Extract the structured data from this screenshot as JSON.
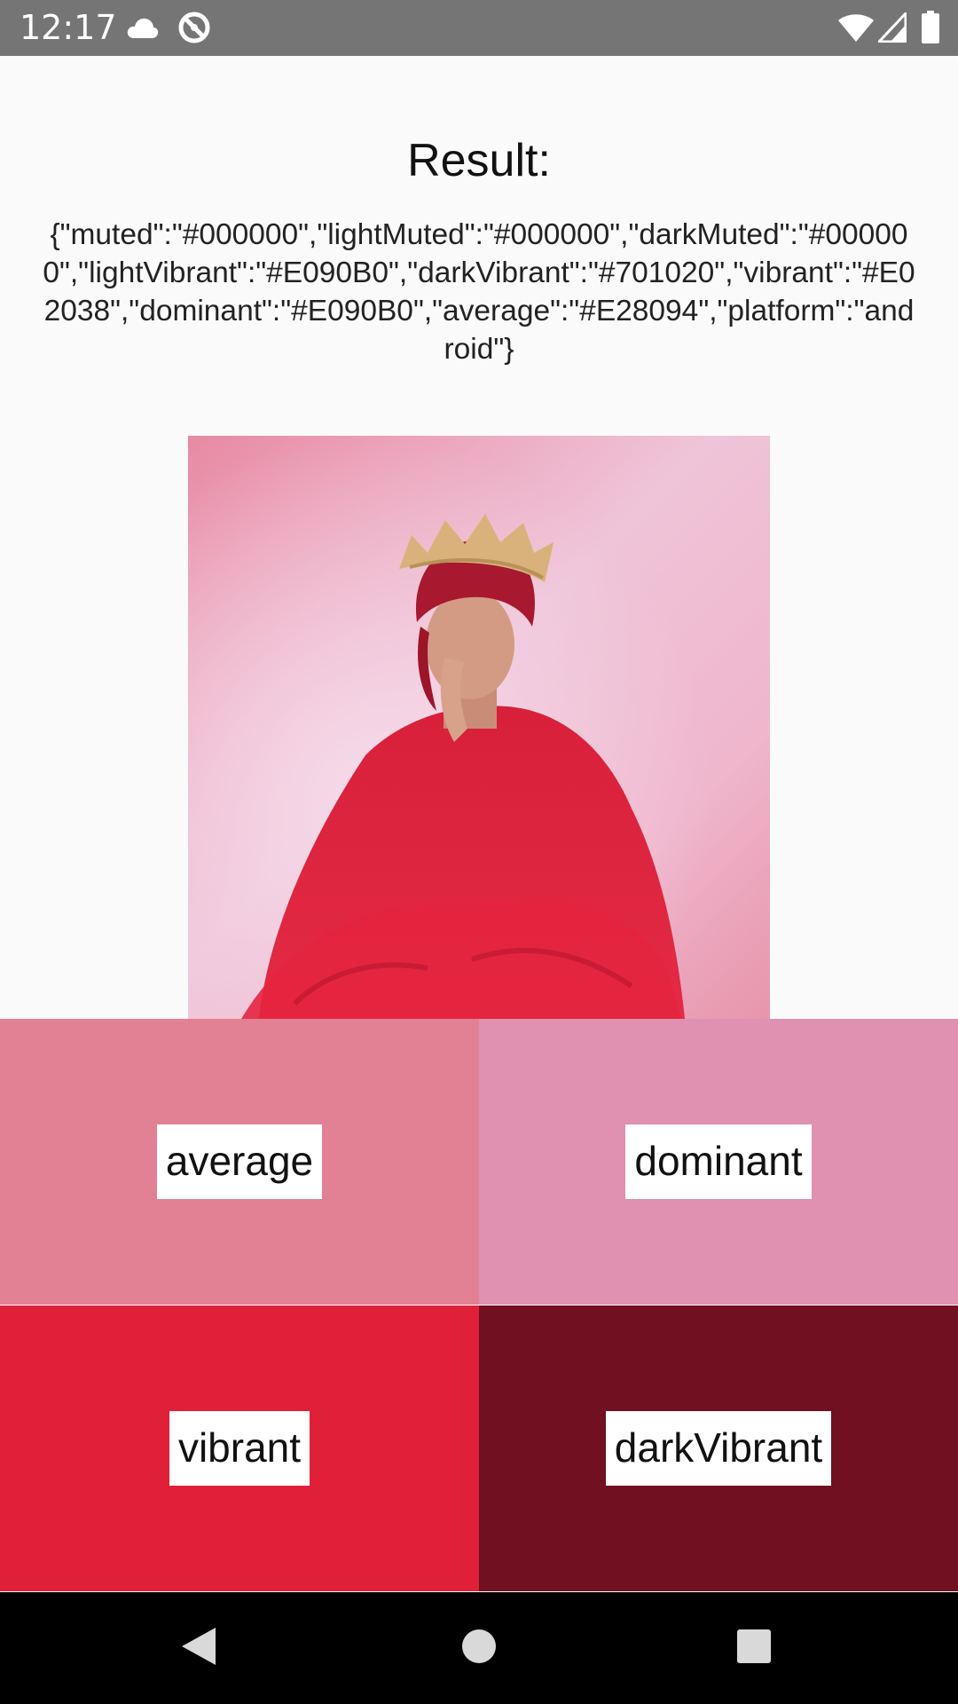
{
  "status_bar": {
    "time": "12:17",
    "left_icons": [
      "cloud-icon",
      "sync-disabled-icon"
    ],
    "right_icons": [
      "wifi-icon",
      "signal-icon",
      "battery-icon"
    ]
  },
  "main": {
    "title": "Result:",
    "json_text": "{\"muted\":\"#000000\",\"lightMuted\":\"#000000\",\"darkMuted\":\"#000000\",\"lightVibrant\":\"#E090B0\",\"darkVibrant\":\"#701020\",\"vibrant\":\"#E02038\",\"dominant\":\"#E090B0\",\"average\":\"#E28094\",\"platform\":\"android\"}"
  },
  "swatches": [
    {
      "label": "average",
      "color": "#E28094"
    },
    {
      "label": "dominant",
      "color": "#E090B0"
    },
    {
      "label": "vibrant",
      "color": "#E02038"
    },
    {
      "label": "darkVibrant",
      "color": "#701020"
    }
  ],
  "colors": {
    "status_bar": "#757575",
    "background": "#FAFAFA",
    "nav_bar": "#000000"
  },
  "nav_bar": {
    "icons": [
      "back-icon",
      "home-icon",
      "recents-icon"
    ]
  }
}
